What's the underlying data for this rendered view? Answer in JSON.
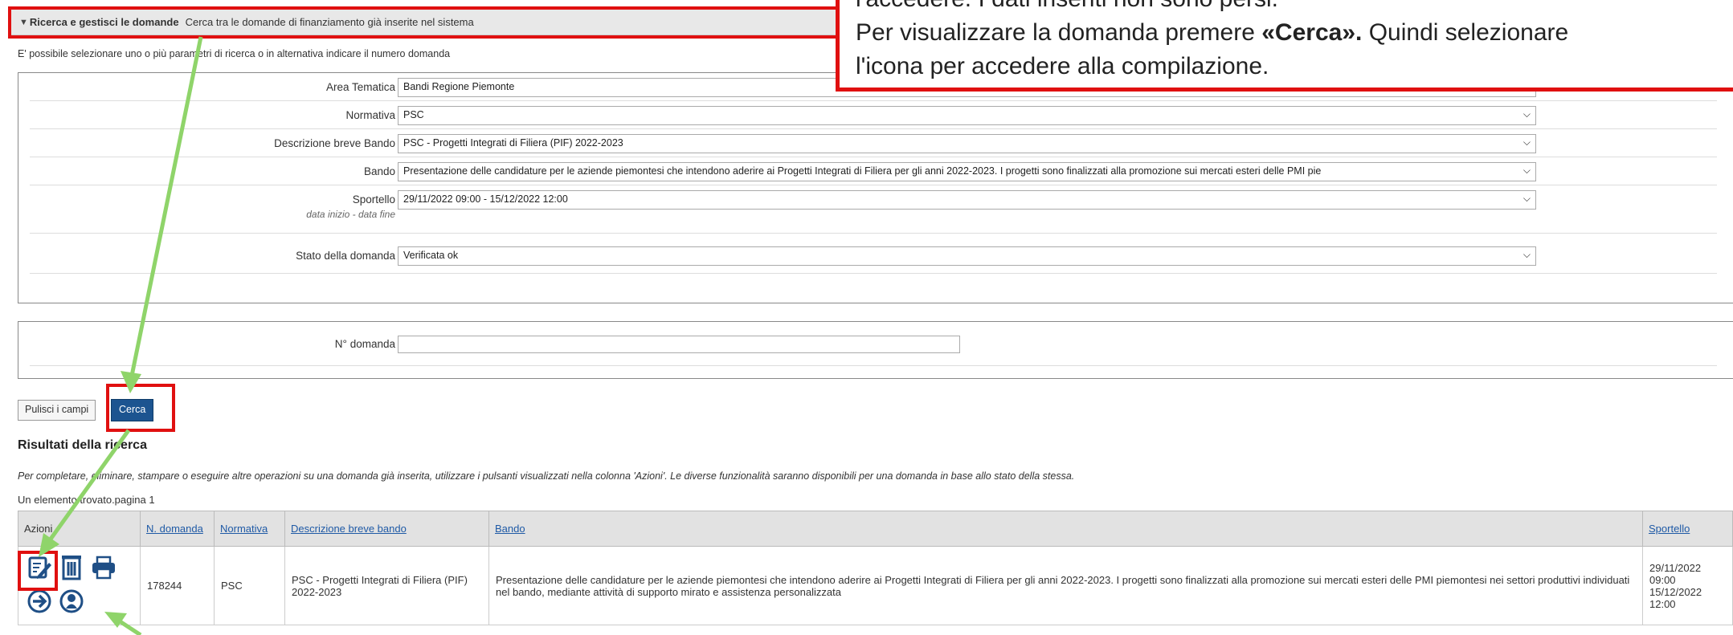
{
  "header": {
    "toggle": "▼",
    "title": "Ricerca e gestisci le domande",
    "subtitle": "Cerca tra le domande di finanziamento già inserite nel sistema"
  },
  "intro": "E' possibile selezionare uno o più parametri di ricerca o in alternativa indicare il numero domanda",
  "form": {
    "area_label": "Area Tematica",
    "area_value": "Bandi Regione Piemonte",
    "normativa_label": "Normativa",
    "normativa_value": "PSC",
    "descr_label": "Descrizione breve Bando",
    "descr_value": "PSC - Progetti Integrati di Filiera (PIF) 2022-2023",
    "bando_label": "Bando",
    "bando_value": "Presentazione delle candidature per le aziende piemontesi che intendono aderire ai Progetti Integrati di Filiera per gli anni 2022-2023. I progetti sono finalizzati alla promozione sui mercati esteri delle PMI pie",
    "sportello_label": "Sportello",
    "sportello_sub": "data inizio - data fine",
    "sportello_value": "29/11/2022 09:00 - 15/12/2022 12:00",
    "stato_label": "Stato della domanda",
    "stato_value": "Verificata ok",
    "num_label": "N° domanda",
    "num_value": ""
  },
  "buttons": {
    "reset": "Pulisci i campi",
    "search": "Cerca"
  },
  "results": {
    "title": "Risultati della ricerca",
    "hint": "Per completare, eliminare, stampare o eseguire altre operazioni su una domanda già inserita, utilizzare i pulsanti visualizzati nella colonna 'Azioni'. Le diverse funzionalità saranno disponibili per una domanda in base allo stato della stessa.",
    "count": "Un elemento trovato.pagina 1",
    "columns": {
      "azioni": "Azioni",
      "n_domanda": "N. domanda",
      "normativa": "Normativa",
      "descrizione": "Descrizione breve bando",
      "bando": "Bando",
      "sportello": "Sportello"
    },
    "row": {
      "n_domanda": "178244",
      "normativa": "PSC",
      "descrizione": "PSC - Progetti Integrati di Filiera (PIF) 2022-2023",
      "bando": "Presentazione delle candidature per le aziende piemontesi che intendono aderire ai Progetti Integrati di Filiera per gli anni 2022-2023. I progetti sono finalizzati alla promozione sui mercati esteri delle PMI piemontesi nei settori produttivi individuati nel bando, mediante attività di supporto mirato e assistenza personalizzata",
      "sportello_start_date": "29/11/2022",
      "sportello_start_time": "09:00",
      "sportello_end_date": "15/12/2022",
      "sportello_end_time": "12:00"
    },
    "action_icons": [
      "edit-icon",
      "trash-icon",
      "print-icon",
      "arrow-right-icon",
      "user-icon"
    ]
  },
  "callout": {
    "line0": "l'accedere. I dati inseriti non sono persi.",
    "line1_a": "Per visualizzare la domanda premere ",
    "line1_b": "«Cerca».",
    "line1_c": " Quindi selezionare",
    "line2": "l'icona per accedere  alla compilazione."
  },
  "colors": {
    "annotation_red": "#e01010",
    "annotation_green": "#8fd46a",
    "button_blue": "#1c5490",
    "link_blue": "#1f5aa6"
  }
}
